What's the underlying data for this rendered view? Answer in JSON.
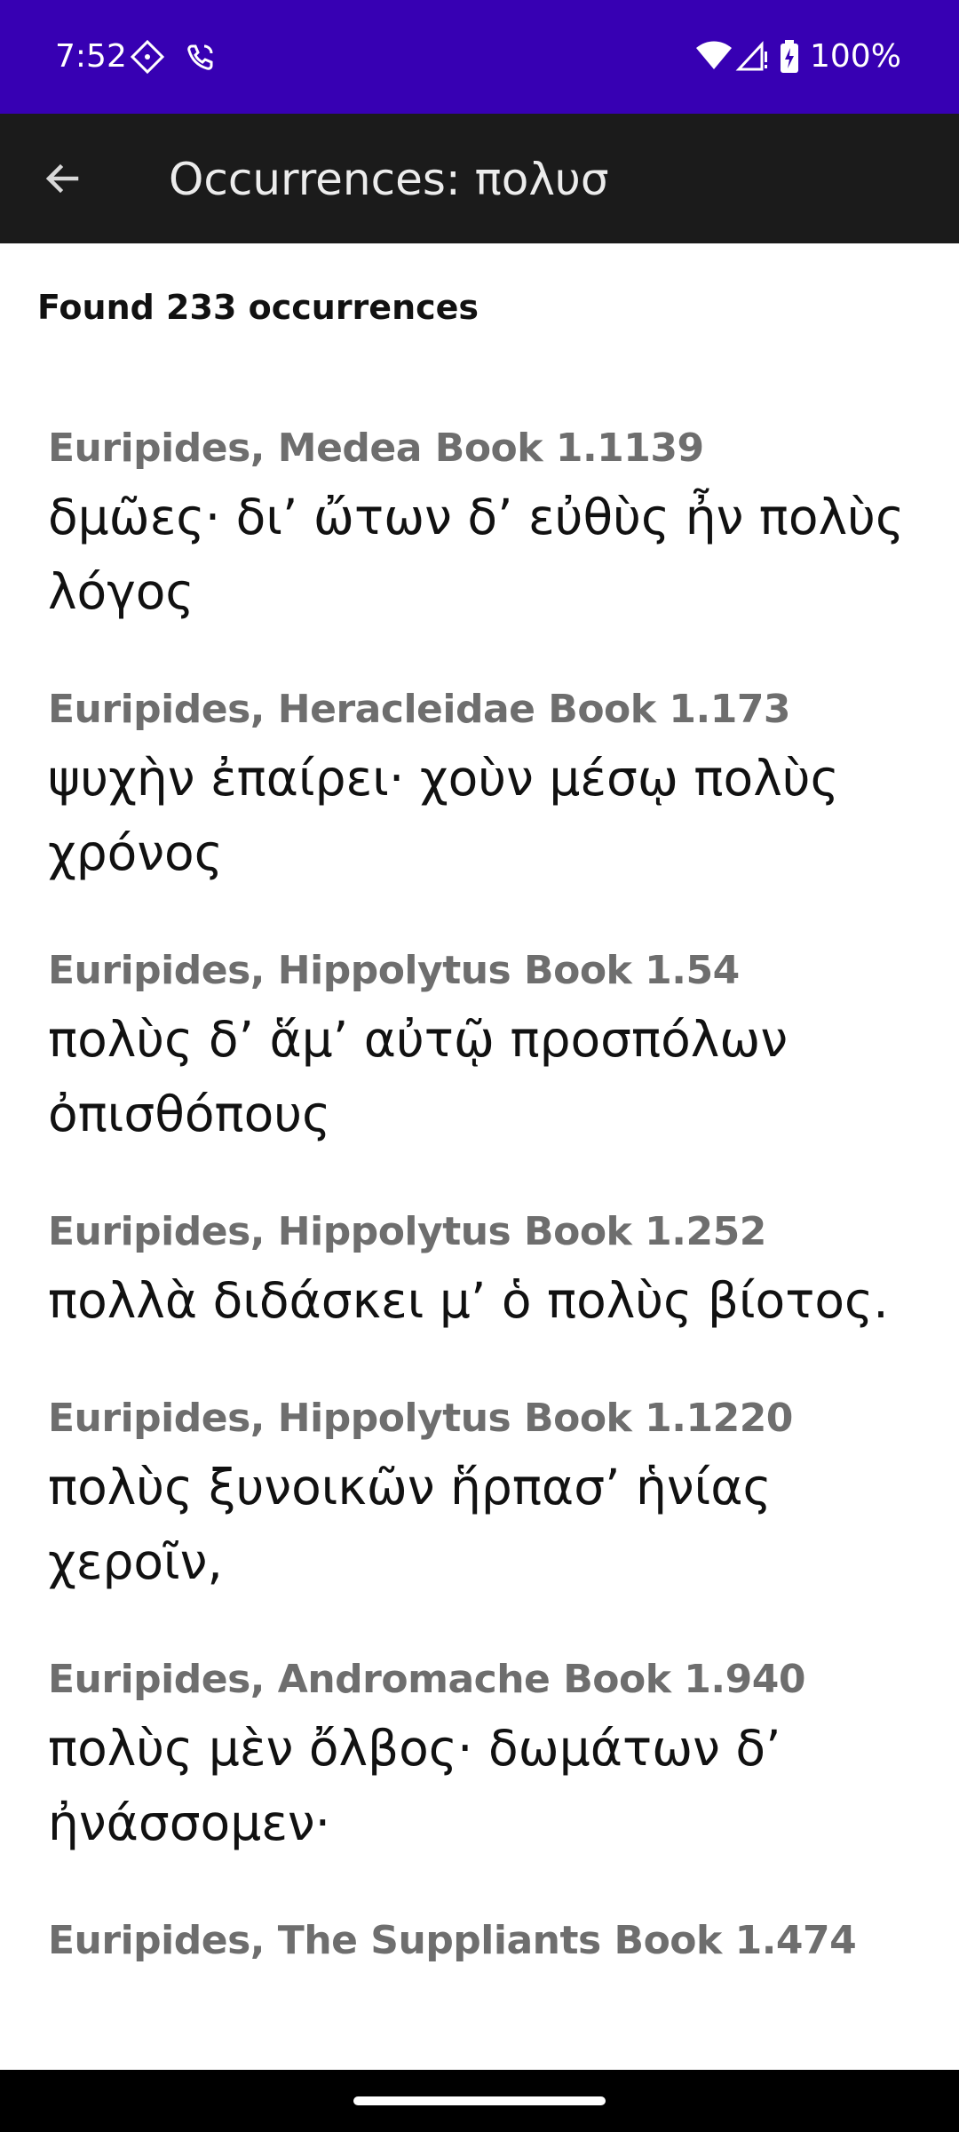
{
  "status_bar": {
    "time": "7:52",
    "battery_text": "100%",
    "icons": [
      "assistant-diamond-icon",
      "wifi-calling-icon",
      "wifi-icon",
      "signal-icon",
      "battery-charging-icon"
    ],
    "background": "#3700b3"
  },
  "app_bar": {
    "title": "Occurrences: πολυσ",
    "back_icon": "arrow-left-icon",
    "background": "#1b1b1b"
  },
  "summary": "Found 233 occurrences",
  "occurrences": [
    {
      "reference": "Euripides, Medea Book 1.1139",
      "text": "δμῶες· δι’ ὤτων δ’ εὐθὺς ἦν πολὺς λόγος"
    },
    {
      "reference": "Euripides, Heracleidae Book 1.173",
      "text": "ψυχὴν ἐπαίρει· χοὺν μέσῳ πολὺς χρόνος"
    },
    {
      "reference": "Euripides, Hippolytus Book 1.54",
      "text": "πολὺς δ’ ἅμ’ αὐτῷ προσπόλων ὀπισθόπους"
    },
    {
      "reference": "Euripides, Hippolytus Book 1.252",
      "text": "πολλὰ διδάσκει μ’ ὁ πολὺς βίοτος."
    },
    {
      "reference": "Euripides, Hippolytus Book 1.1220",
      "text": "πολὺς ξυνοικῶν ἥρπασ’ ἡνίας χεροῖν,"
    },
    {
      "reference": "Euripides, Andromache Book 1.940",
      "text": "πολὺς μὲν ὄλβος· δωμάτων δ’ ἠνάσσομεν·"
    },
    {
      "reference": "Euripides, The Suppliants Book 1.474",
      "text": ""
    }
  ]
}
